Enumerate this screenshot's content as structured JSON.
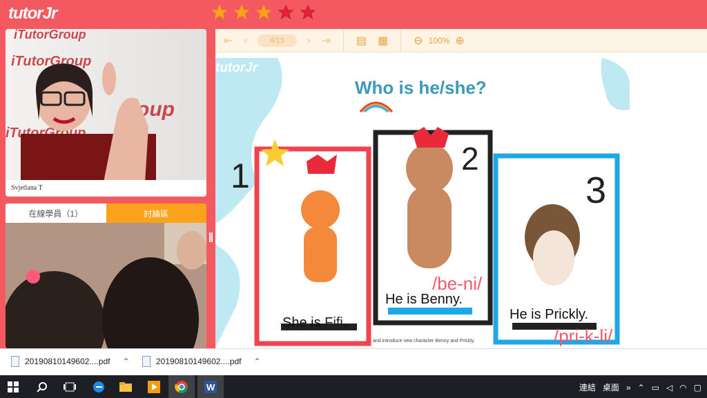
{
  "app": {
    "logo": "tutorJr"
  },
  "stars": {
    "rating": 5,
    "colors": [
      "#f9a21a",
      "#f9a21a",
      "#f9a21a",
      "#e8203a",
      "#e8203a"
    ]
  },
  "tutor_panel": {
    "name": "Svjetlana T",
    "watermark": "iTutorGroup"
  },
  "tabs": [
    {
      "label": "在線學員（1）"
    },
    {
      "label": "討論區"
    }
  ],
  "toolbar": {
    "page": "4/15",
    "zoom": "100%"
  },
  "slide": {
    "brand": "tutorJr",
    "title": "Who is he/she?",
    "cards": [
      {
        "number": "1",
        "sentence_pre": "She is ",
        "name": "Fifi",
        "suffix": "."
      },
      {
        "number": "2",
        "sentence_pre": "He is ",
        "name": "Benny",
        "suffix": ".",
        "pron": "/be-ni/"
      },
      {
        "number": "3",
        "sentence_pre": "He is ",
        "name": "Prickly",
        "suffix": ".",
        "pron": "/pri-k-li/"
      }
    ],
    "footnote": "and introduce new character Benny and Prickly."
  },
  "downloads": [
    {
      "file": "20190810149602....pdf"
    },
    {
      "file": "20190810149602....pdf"
    }
  ],
  "tray": {
    "network": "連結",
    "desktop": "桌面",
    "chevron": "»"
  }
}
